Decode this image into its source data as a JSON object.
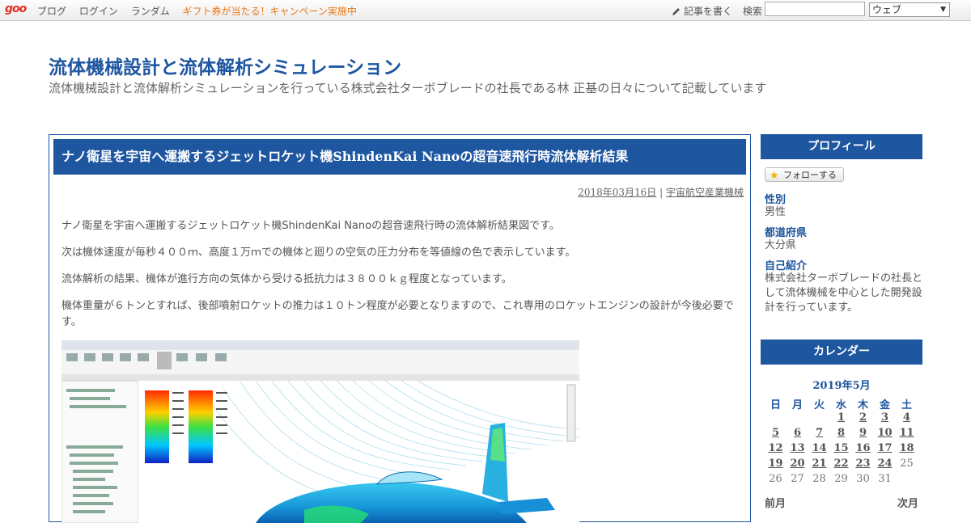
{
  "topbar": {
    "logo": "goo",
    "nav": [
      "ブログ",
      "ログイン",
      "ランダム"
    ],
    "promo": "ギフト券が当たる！キャンペーン実施中",
    "write": "記事を書く",
    "search_label": "検索",
    "search_value": "",
    "search_scope": "ウェブ"
  },
  "blog": {
    "title": "流体機械設計と流体解析シミュレーション",
    "description": "流体機械設計と流体解析シミュレーションを行っている株式会社ターボブレードの社長である林 正基の日々について記載しています"
  },
  "entry": {
    "title": "ナノ衛星を宇宙へ運搬するジェットロケット機ShindenKai Nanoの超音速飛行時流体解析結果",
    "date": "2018年03月16日",
    "separator": "|",
    "category": "宇宙航空産業機械",
    "paragraphs": [
      "ナノ衛星を宇宙へ運搬するジェットロケット機ShindenKai Nanoの超音速飛行時の流体解析結果図です。",
      "次は機体速度が毎秒４００ｍ、高度１万ｍでの機体と廻りの空気の圧力分布を等値線の色で表示しています。",
      "流体解析の結果、機体が進行方向の気体から受ける抵抗力は３８００ｋｇ程度となっています。",
      "機体重量が６トンとすれば、後部噴射ロケットの推力は１０トン程度が必要となりますので、これ専用のロケットエンジンの設計が今後必要です。"
    ]
  },
  "sidebar": {
    "profile_heading": "プロフィール",
    "follow_label": "フォローする",
    "fields": [
      {
        "label": "性別",
        "value": "男性"
      },
      {
        "label": "都道府県",
        "value": "大分県"
      },
      {
        "label": "自己紹介",
        "value": "株式会社ターボブレードの社長として流体機械を中心とした開発設計を行っています。"
      }
    ],
    "calendar_heading": "カレンダー",
    "calendar": {
      "month": "2019年5月",
      "weekdays": [
        "日",
        "月",
        "火",
        "水",
        "木",
        "金",
        "土"
      ],
      "weeks": [
        [
          "",
          "",
          "",
          "1",
          "2",
          "3",
          "4"
        ],
        [
          "5",
          "6",
          "7",
          "8",
          "9",
          "10",
          "11"
        ],
        [
          "12",
          "13",
          "14",
          "15",
          "16",
          "17",
          "18"
        ],
        [
          "19",
          "20",
          "21",
          "22",
          "23",
          "24",
          "25"
        ],
        [
          "26",
          "27",
          "28",
          "29",
          "30",
          "31",
          ""
        ]
      ],
      "linked_through": 24,
      "prev": "前月",
      "next": "次月"
    }
  },
  "colors": {
    "brand_blue": "#1e56a0",
    "promo_orange": "#e77817",
    "logo_red": "#e62e1e"
  }
}
